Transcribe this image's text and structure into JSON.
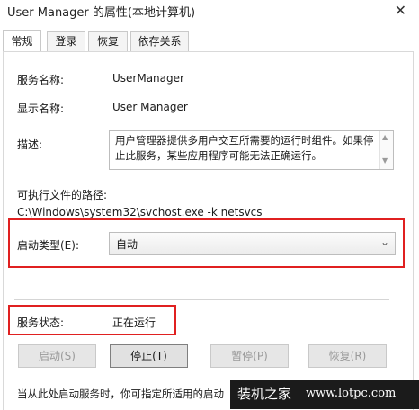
{
  "window": {
    "title": "User Manager 的属性(本地计算机)",
    "close_glyph": "✕"
  },
  "tabs": [
    {
      "label": "常规",
      "active": true
    },
    {
      "label": "登录",
      "active": false
    },
    {
      "label": "恢复",
      "active": false
    },
    {
      "label": "依存关系",
      "active": false
    }
  ],
  "general": {
    "service_name_label": "服务名称:",
    "service_name": "UserManager",
    "display_name_label": "显示名称:",
    "display_name": "User Manager",
    "description_label": "描述:",
    "description": "用户管理器提供多用户交互所需要的运行时组件。如果停止此服务，某些应用程序可能无法正确运行。",
    "exe_path_label": "可执行文件的路径:",
    "exe_path": "C:\\Windows\\system32\\svchost.exe -k netsvcs",
    "startup_type_label": "启动类型(E):",
    "startup_type": "自动",
    "status_label": "服务状态:",
    "status": "正在运行"
  },
  "buttons": [
    {
      "label": "启动(S)",
      "enabled": false
    },
    {
      "label": "停止(T)",
      "enabled": true
    },
    {
      "label": "暂停(P)",
      "enabled": false
    },
    {
      "label": "恢复(R)",
      "enabled": false
    }
  ],
  "footer_text": "当从此处启动服务时，你可指定所适用的启动",
  "watermark": {
    "text": "装机之家",
    "url": "www.lotpc.com"
  },
  "colors": {
    "highlight_box": "#e02020",
    "watermark_bg": "#1b1b1b"
  }
}
